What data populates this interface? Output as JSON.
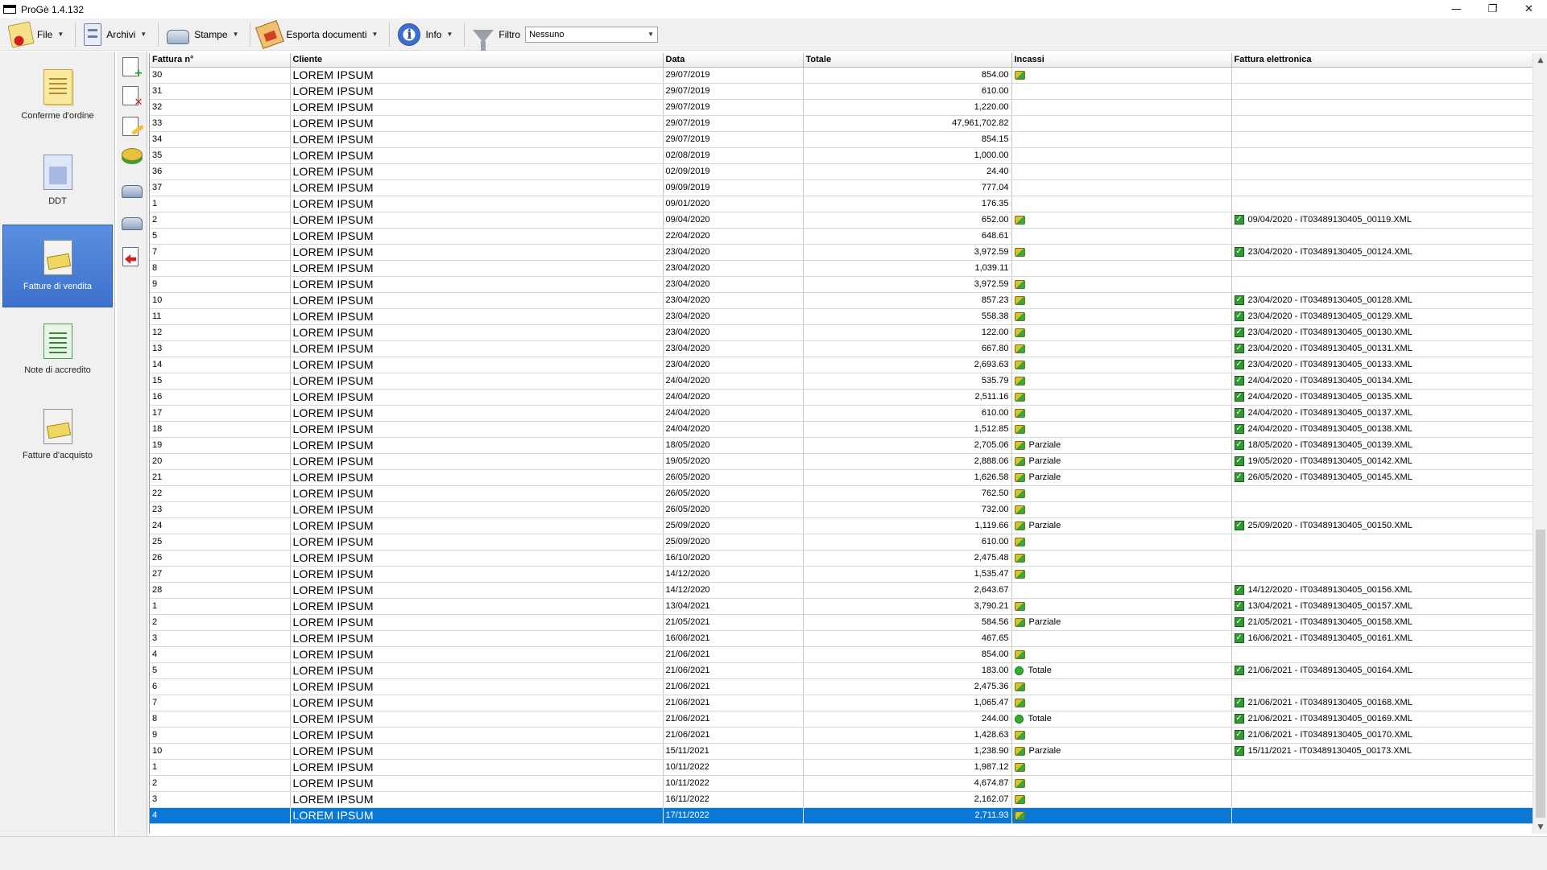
{
  "window": {
    "title": "ProGè 1.4.132",
    "minimize": "—",
    "restore": "❐",
    "close": "✕"
  },
  "toolbar": {
    "file": "File",
    "archivi": "Archivi",
    "stampe": "Stampe",
    "esporta": "Esporta documenti",
    "info": "Info",
    "filtro_label": "Filtro",
    "filtro_value": "Nessuno"
  },
  "nav": [
    {
      "label": "Conferme d'ordine",
      "icon": "order-confirmation-icon"
    },
    {
      "label": "DDT",
      "icon": "ddt-icon"
    },
    {
      "label": "Fatture di vendita",
      "icon": "sales-invoice-icon",
      "active": true
    },
    {
      "label": "Note di accredito",
      "icon": "credit-note-icon"
    },
    {
      "label": "Fatture d'acquisto",
      "icon": "purchase-invoice-icon"
    }
  ],
  "actions": [
    "add-document-icon",
    "delete-document-icon",
    "edit-document-icon",
    "payments-icon",
    "print-icon",
    "print-preview-icon",
    "export-arrow-icon"
  ],
  "grid": {
    "columns": [
      "Fattura n°",
      "Cliente",
      "Data",
      "Totale",
      "Incassi",
      "Fattura elettronica"
    ],
    "rows": [
      [
        "30",
        "LOREM IPSUM",
        "29/07/2019",
        "854.00",
        "I",
        ""
      ],
      [
        "31",
        "LOREM IPSUM",
        "29/07/2019",
        "610.00",
        "",
        ""
      ],
      [
        "32",
        "LOREM IPSUM",
        "29/07/2019",
        "1,220.00",
        "",
        ""
      ],
      [
        "33",
        "LOREM IPSUM",
        "29/07/2019",
        "47,961,702.82",
        "",
        ""
      ],
      [
        "34",
        "LOREM IPSUM",
        "29/07/2019",
        "854.15",
        "",
        ""
      ],
      [
        "35",
        "LOREM IPSUM",
        "02/08/2019",
        "1,000.00",
        "",
        ""
      ],
      [
        "36",
        "LOREM IPSUM",
        "02/09/2019",
        "24.40",
        "",
        ""
      ],
      [
        "37",
        "LOREM IPSUM",
        "09/09/2019",
        "777.04",
        "",
        ""
      ],
      [
        "1",
        "LOREM IPSUM",
        "09/01/2020",
        "176.35",
        "",
        ""
      ],
      [
        "2",
        "LOREM IPSUM",
        "09/04/2020",
        "652.00",
        "I",
        "09/04/2020 - IT03489130405_00119.XML"
      ],
      [
        "5",
        "LOREM IPSUM",
        "22/04/2020",
        "648.61",
        "",
        ""
      ],
      [
        "7",
        "LOREM IPSUM",
        "23/04/2020",
        "3,972.59",
        "I",
        "23/04/2020 - IT03489130405_00124.XML"
      ],
      [
        "8",
        "LOREM IPSUM",
        "23/04/2020",
        "1,039.11",
        "",
        ""
      ],
      [
        "9",
        "LOREM IPSUM",
        "23/04/2020",
        "3,972.59",
        "I",
        ""
      ],
      [
        "10",
        "LOREM IPSUM",
        "23/04/2020",
        "857.23",
        "I",
        "23/04/2020 - IT03489130405_00128.XML"
      ],
      [
        "11",
        "LOREM IPSUM",
        "23/04/2020",
        "558.38",
        "I",
        "23/04/2020 - IT03489130405_00129.XML"
      ],
      [
        "12",
        "LOREM IPSUM",
        "23/04/2020",
        "122.00",
        "I",
        "23/04/2020 - IT03489130405_00130.XML"
      ],
      [
        "13",
        "LOREM IPSUM",
        "23/04/2020",
        "667.80",
        "I",
        "23/04/2020 - IT03489130405_00131.XML"
      ],
      [
        "14",
        "LOREM IPSUM",
        "23/04/2020",
        "2,693.63",
        "I",
        "23/04/2020 - IT03489130405_00133.XML"
      ],
      [
        "15",
        "LOREM IPSUM",
        "24/04/2020",
        "535.79",
        "I",
        "24/04/2020 - IT03489130405_00134.XML"
      ],
      [
        "16",
        "LOREM IPSUM",
        "24/04/2020",
        "2,511.16",
        "I",
        "24/04/2020 - IT03489130405_00135.XML"
      ],
      [
        "17",
        "LOREM IPSUM",
        "24/04/2020",
        "610.00",
        "I",
        "24/04/2020 - IT03489130405_00137.XML"
      ],
      [
        "18",
        "LOREM IPSUM",
        "24/04/2020",
        "1,512.85",
        "I",
        "24/04/2020 - IT03489130405_00138.XML"
      ],
      [
        "19",
        "LOREM IPSUM",
        "18/05/2020",
        "2,705.06",
        "I|Parziale",
        "18/05/2020 - IT03489130405_00139.XML"
      ],
      [
        "20",
        "LOREM IPSUM",
        "19/05/2020",
        "2,888.06",
        "I|Parziale",
        "19/05/2020 - IT03489130405_00142.XML"
      ],
      [
        "21",
        "LOREM IPSUM",
        "26/05/2020",
        "1,626.58",
        "I|Parziale",
        "26/05/2020 - IT03489130405_00145.XML"
      ],
      [
        "22",
        "LOREM IPSUM",
        "26/05/2020",
        "762.50",
        "I",
        ""
      ],
      [
        "23",
        "LOREM IPSUM",
        "26/05/2020",
        "732.00",
        "I",
        ""
      ],
      [
        "24",
        "LOREM IPSUM",
        "25/09/2020",
        "1,119.66",
        "I|Parziale",
        "25/09/2020 - IT03489130405_00150.XML"
      ],
      [
        "25",
        "LOREM IPSUM",
        "25/09/2020",
        "610.00",
        "I",
        ""
      ],
      [
        "26",
        "LOREM IPSUM",
        "16/10/2020",
        "2,475.48",
        "I",
        ""
      ],
      [
        "27",
        "LOREM IPSUM",
        "14/12/2020",
        "1,535.47",
        "I",
        ""
      ],
      [
        "28",
        "LOREM IPSUM",
        "14/12/2020",
        "2,643.67",
        "",
        "14/12/2020 - IT03489130405_00156.XML"
      ],
      [
        "1",
        "LOREM IPSUM",
        "13/04/2021",
        "3,790.21",
        "I",
        "13/04/2021 - IT03489130405_00157.XML"
      ],
      [
        "2",
        "LOREM IPSUM",
        "21/05/2021",
        "584.56",
        "I|Parziale",
        "21/05/2021 - IT03489130405_00158.XML"
      ],
      [
        "3",
        "LOREM IPSUM",
        "16/06/2021",
        "467.65",
        "",
        "16/06/2021 - IT03489130405_00161.XML"
      ],
      [
        "4",
        "LOREM IPSUM",
        "21/06/2021",
        "854.00",
        "I",
        ""
      ],
      [
        "5",
        "LOREM IPSUM",
        "21/06/2021",
        "183.00",
        "T|Totale",
        "21/06/2021 - IT03489130405_00164.XML"
      ],
      [
        "6",
        "LOREM IPSUM",
        "21/06/2021",
        "2,475.36",
        "I",
        ""
      ],
      [
        "7",
        "LOREM IPSUM",
        "21/06/2021",
        "1,065.47",
        "I",
        "21/06/2021 - IT03489130405_00168.XML"
      ],
      [
        "8",
        "LOREM IPSUM",
        "21/06/2021",
        "244.00",
        "T|Totale",
        "21/06/2021 - IT03489130405_00169.XML"
      ],
      [
        "9",
        "LOREM IPSUM",
        "21/06/2021",
        "1,428.63",
        "I",
        "21/06/2021 - IT03489130405_00170.XML"
      ],
      [
        "10",
        "LOREM IPSUM",
        "15/11/2021",
        "1,238.90",
        "I|Parziale",
        "15/11/2021 - IT03489130405_00173.XML"
      ],
      [
        "1",
        "LOREM IPSUM",
        "10/11/2022",
        "1,987.12",
        "I",
        ""
      ],
      [
        "2",
        "LOREM IPSUM",
        "10/11/2022",
        "4,674.87",
        "I",
        ""
      ],
      [
        "3",
        "LOREM IPSUM",
        "16/11/2022",
        "2,162.07",
        "I",
        ""
      ],
      [
        "4",
        "LOREM IPSUM",
        "17/11/2022",
        "2,711.93",
        "I",
        ""
      ]
    ],
    "selected_row": 46
  },
  "colors": {
    "selection": "#0a78d7",
    "nav_active": "#3d72cc"
  }
}
